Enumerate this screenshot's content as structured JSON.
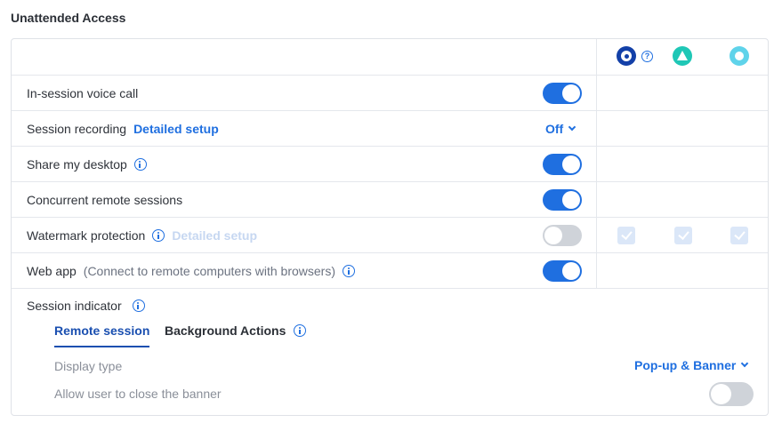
{
  "section": {
    "title": "Unattended Access"
  },
  "platforms": {
    "windows_icon": "windows-platform-icon",
    "help_icon": "question-icon",
    "help_glyph": "?",
    "mac_icon": "mac-platform-icon",
    "linux_icon": "linux-platform-icon"
  },
  "rows": {
    "voice_call": {
      "label": "In-session voice call",
      "enabled": true
    },
    "session_recording": {
      "label": "Session recording",
      "link": "Detailed setup",
      "value": "Off"
    },
    "share_desktop": {
      "label": "Share my desktop",
      "enabled": true
    },
    "concurrent": {
      "label": "Concurrent remote sessions",
      "enabled": true
    },
    "watermark": {
      "label": "Watermark protection",
      "link": "Detailed setup",
      "enabled": false,
      "platform_checks": [
        true,
        true,
        true
      ]
    },
    "web_app": {
      "label": "Web app",
      "note": "(Connect to remote computers with browsers)",
      "enabled": true
    }
  },
  "session_indicator": {
    "label": "Session indicator",
    "tabs": [
      {
        "label": "Remote session",
        "active": true
      },
      {
        "label": "Background Actions",
        "active": false
      }
    ],
    "display_type": {
      "label": "Display type",
      "value": "Pop-up & Banner"
    },
    "allow_close": {
      "label": "Allow user to close the banner",
      "enabled": false
    }
  },
  "colors": {
    "accent": "#1f6fe0",
    "toggle_off": "#cfd3d9",
    "windows": "#1340a8",
    "mac": "#1fc7b6",
    "linux": "#5fd3ea"
  }
}
